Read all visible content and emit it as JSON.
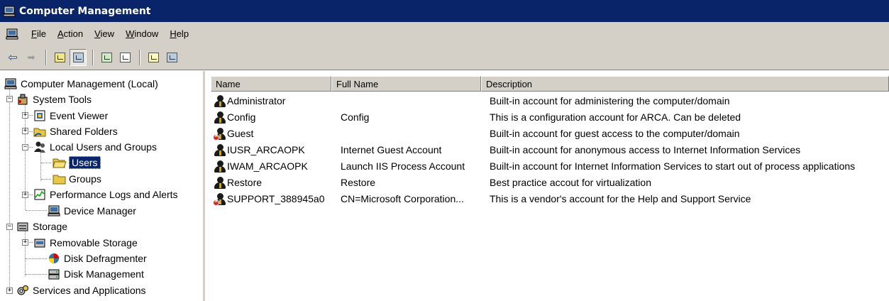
{
  "window": {
    "title": "Computer Management"
  },
  "menu": [
    {
      "label": "File",
      "u": "F",
      "rest": "ile"
    },
    {
      "label": "Action",
      "u": "A",
      "rest": "ction"
    },
    {
      "label": "View",
      "u": "V",
      "rest": "iew"
    },
    {
      "label": "Window",
      "u": "W",
      "rest": "indow"
    },
    {
      "label": "Help",
      "u": "H",
      "rest": "elp"
    }
  ],
  "toolbar": [
    {
      "icon": "back-arrow-icon",
      "glyph": "⇦"
    },
    {
      "icon": "forward-arrow-icon",
      "glyph": "➡"
    },
    {
      "icon": "up-one-level-icon"
    },
    {
      "icon": "show-hide-console-tree-icon"
    },
    {
      "icon": "refresh-icon"
    },
    {
      "icon": "export-list-icon"
    },
    {
      "icon": "help-icon"
    },
    {
      "icon": "show-hide-action-pane-icon"
    }
  ],
  "tree": [
    {
      "label": "Computer Management (Local)",
      "icon": "computer-icon"
    },
    {
      "label": "System Tools",
      "icon": "system-tools-icon"
    },
    {
      "label": "Event Viewer",
      "icon": "event-viewer-icon"
    },
    {
      "label": "Shared Folders",
      "icon": "shared-folders-icon"
    },
    {
      "label": "Local Users and Groups",
      "icon": "users-groups-icon"
    },
    {
      "label": "Users",
      "icon": "folder-open-icon",
      "selected": true
    },
    {
      "label": "Groups",
      "icon": "folder-icon"
    },
    {
      "label": "Performance Logs and Alerts",
      "icon": "performance-icon"
    },
    {
      "label": "Device Manager",
      "icon": "device-manager-icon"
    },
    {
      "label": "Storage",
      "icon": "storage-icon"
    },
    {
      "label": "Removable Storage",
      "icon": "removable-storage-icon"
    },
    {
      "label": "Disk Defragmenter",
      "icon": "disk-defragmenter-icon"
    },
    {
      "label": "Disk Management",
      "icon": "disk-management-icon"
    },
    {
      "label": "Services and Applications",
      "icon": "services-icon"
    }
  ],
  "list": {
    "columns": [
      "Name",
      "Full Name",
      "Description"
    ],
    "rows": [
      {
        "name": "Administrator",
        "full_name": "",
        "description": "Built-in account for administering the computer/domain",
        "disabled": false
      },
      {
        "name": "Config",
        "full_name": "Config",
        "description": "This is a configuration account for ARCA. Can be deleted",
        "disabled": false
      },
      {
        "name": "Guest",
        "full_name": "",
        "description": "Built-in account for guest access to the computer/domain",
        "disabled": true
      },
      {
        "name": "IUSR_ARCAOPK",
        "full_name": "Internet Guest Account",
        "description": "Built-in account for anonymous access to Internet Information Services",
        "disabled": false
      },
      {
        "name": "IWAM_ARCAOPK",
        "full_name": "Launch IIS Process Account",
        "description": "Built-in account for Internet Information Services to start out of process applications",
        "disabled": false
      },
      {
        "name": "Restore",
        "full_name": "Restore",
        "description": "Best practice accout for virtualization",
        "disabled": false
      },
      {
        "name": "SUPPORT_388945a0",
        "full_name": "CN=Microsoft Corporation...",
        "description": "This is a vendor's account for the Help and Support Service",
        "disabled": true
      }
    ]
  }
}
